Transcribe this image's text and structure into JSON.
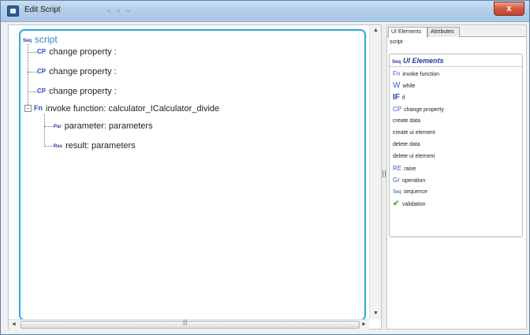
{
  "window": {
    "title": "Edit Script",
    "close_label": "x"
  },
  "tree": {
    "root": {
      "badge": "Seq",
      "label": "script"
    },
    "items": [
      {
        "badge": "CP",
        "label": "change property :"
      },
      {
        "badge": "CP",
        "label": "change property :"
      },
      {
        "badge": "CP",
        "label": "change property :"
      },
      {
        "badge": "Fn",
        "label": "invoke function: calculator_ICalculator_divide",
        "expander": "-"
      }
    ],
    "children": [
      {
        "badge": "Par",
        "label": "parameter: parameters"
      },
      {
        "badge": "Res",
        "label": "result: parameters"
      }
    ]
  },
  "scrollbars": {
    "up_arrow": "▲",
    "down_arrow": "▼",
    "left_arrow": "◄",
    "right_arrow": "►",
    "grip": "|||"
  },
  "right_panel": {
    "tabs": [
      "UI Elements",
      "Attributes"
    ],
    "active_tab": "UI Elements",
    "breadcrumb": "script",
    "palette": {
      "header_badge": "Seq",
      "header": "UI Elements",
      "items": [
        {
          "icon": "Fn",
          "label": "invoke function"
        },
        {
          "icon": "W",
          "label": "while"
        },
        {
          "icon": "IF",
          "label": "if"
        },
        {
          "icon": "CP",
          "label": "change property"
        },
        {
          "icon": "",
          "label": "create data"
        },
        {
          "icon": "",
          "label": "create ui element"
        },
        {
          "icon": "",
          "label": "delete data"
        },
        {
          "icon": "",
          "label": "delete ui element"
        },
        {
          "icon": "RE",
          "label": "raise"
        },
        {
          "icon": "Gr",
          "label": "operation"
        },
        {
          "icon": "Seq",
          "label": "sequence"
        },
        {
          "icon": "✔",
          "label": "validation"
        }
      ]
    }
  }
}
